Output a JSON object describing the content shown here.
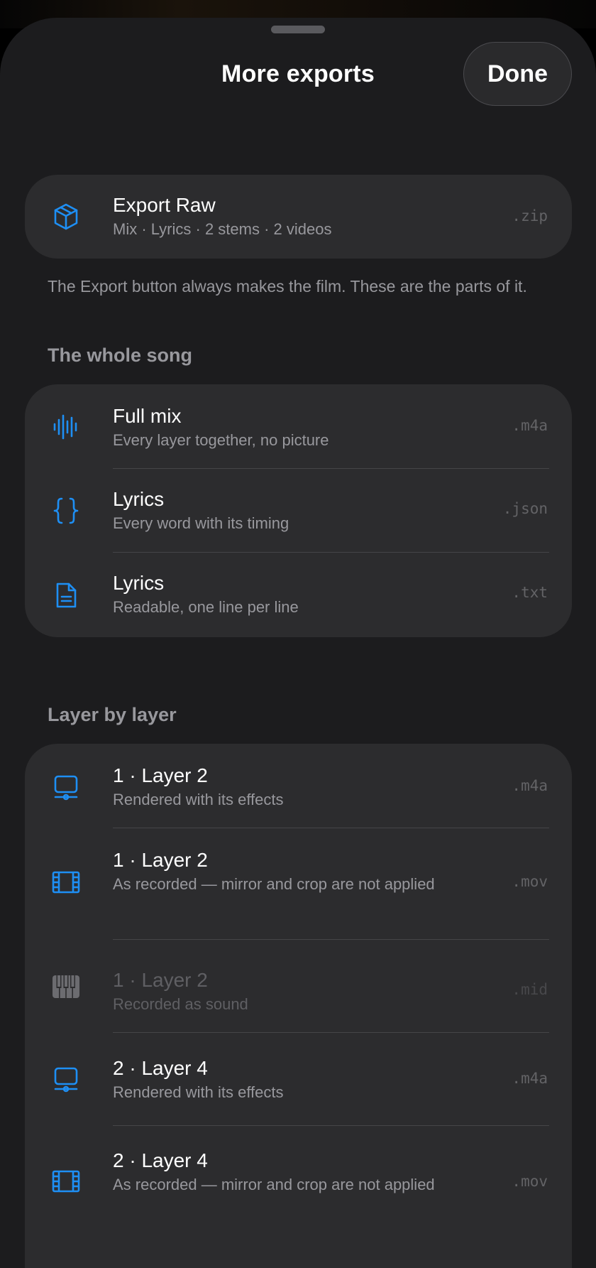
{
  "header": {
    "title": "More exports",
    "done_label": "Done"
  },
  "export_raw": {
    "icon": "cube-icon",
    "title": "Export Raw",
    "subtitle": "Mix · Lyrics · 2 stems · 2 videos",
    "ext": ".zip"
  },
  "footnote": "The Export button always makes the film. These are the parts of it.",
  "sections": {
    "whole_song": {
      "header": "The whole song",
      "items": [
        {
          "icon": "waveform-icon",
          "title": "Full mix",
          "subtitle": "Every layer together, no picture",
          "ext": ".m4a"
        },
        {
          "icon": "curly-braces-icon",
          "title": "Lyrics",
          "subtitle": "Every word with its timing",
          "ext": ".json"
        },
        {
          "icon": "document-icon",
          "title": "Lyrics",
          "subtitle": "Readable, one line per line",
          "ext": ".txt"
        }
      ]
    },
    "layer_by_layer": {
      "header": "Layer by layer",
      "items": [
        {
          "icon": "monitor-icon",
          "title": "1 · Layer 2",
          "subtitle": "Rendered with its effects",
          "ext": ".m4a",
          "enabled": true
        },
        {
          "icon": "film-icon",
          "title": "1 · Layer 2",
          "subtitle": "As recorded — mirror and crop are not applied",
          "ext": ".mov",
          "enabled": true
        },
        {
          "icon": "piano-keys-icon",
          "title": "1 · Layer 2",
          "subtitle": "Recorded as sound",
          "ext": ".mid",
          "enabled": false
        },
        {
          "icon": "monitor-icon",
          "title": "2 · Layer 4",
          "subtitle": "Rendered with its effects",
          "ext": ".m4a",
          "enabled": true
        },
        {
          "icon": "film-icon",
          "title": "2 · Layer 4",
          "subtitle": "As recorded — mirror and crop are not applied",
          "ext": ".mov",
          "enabled": true
        }
      ]
    }
  },
  "colors": {
    "accent": "#1e8ff4",
    "sheet_background": "#1c1c1e",
    "card_background": "#2c2c2e",
    "secondary_text": "#98989d"
  }
}
